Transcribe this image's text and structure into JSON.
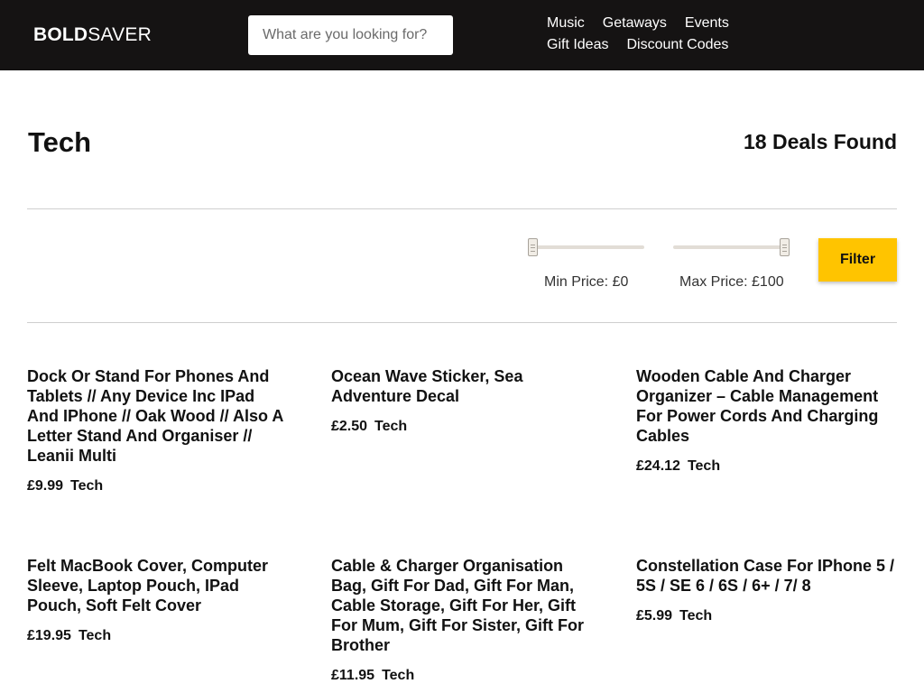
{
  "header": {
    "logo_bold": "BOLD",
    "logo_light": "SAVER",
    "search_placeholder": "What are you looking for?",
    "nav": [
      "Music",
      "Getaways",
      "Events",
      "Gift Ideas",
      "Discount Codes"
    ]
  },
  "main": {
    "title": "Tech",
    "deal_count": "18 Deals Found",
    "filter": {
      "min_label": "Min Price: £0",
      "max_label": "Max Price: £100",
      "min_value": 0,
      "max_value": 100,
      "button_label": "Filter"
    },
    "deals": [
      {
        "title": "Dock Or Stand For Phones And Tablets // Any Device Inc IPad And IPhone // Oak Wood // Also A Letter Stand And Organiser // Leanii Multi",
        "price": "£9.99",
        "category": "Tech"
      },
      {
        "title": "Ocean Wave Sticker, Sea Adventure Decal",
        "price": "£2.50",
        "category": "Tech"
      },
      {
        "title": "Wooden Cable And Charger Organizer – Cable Management For Power Cords And Charging Cables",
        "price": "£24.12",
        "category": "Tech"
      },
      {
        "title": "Felt MacBook Cover, Computer Sleeve, Laptop Pouch, IPad Pouch, Soft Felt Cover",
        "price": "£19.95",
        "category": "Tech"
      },
      {
        "title": "Cable & Charger Organisation Bag, Gift For Dad, Gift For Man, Cable Storage, Gift For Her, Gift For Mum, Gift For Sister, Gift For Brother",
        "price": "£11.95",
        "category": "Tech"
      },
      {
        "title": "Constellation Case For IPhone 5 / 5S / SE 6 / 6S / 6+ / 7/ 8",
        "price": "£5.99",
        "category": "Tech"
      }
    ]
  }
}
